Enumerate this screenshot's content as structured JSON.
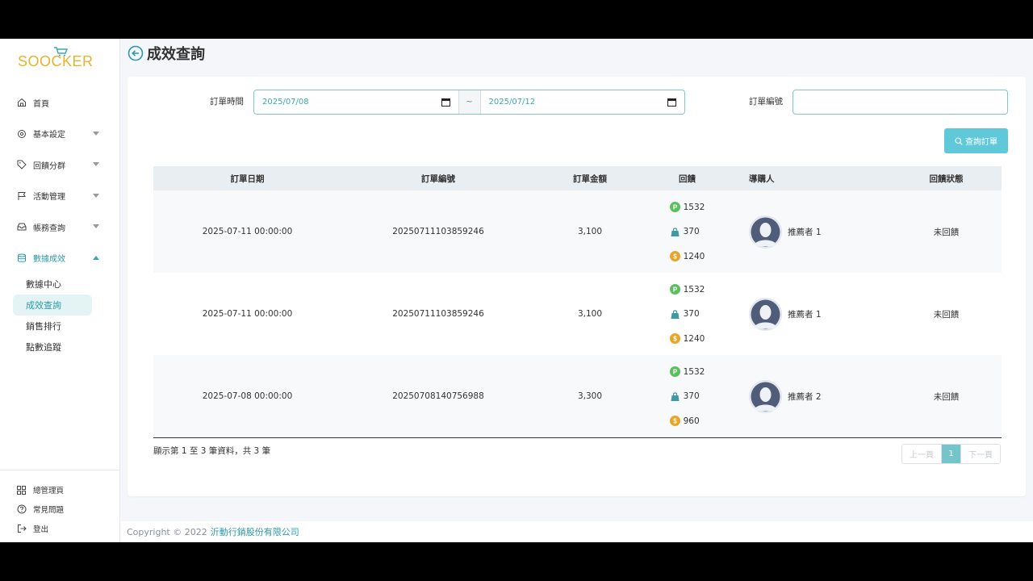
{
  "brand": {
    "logo_text": "SOOCKER",
    "accent": "#e8b22c"
  },
  "sidebar": {
    "items": [
      {
        "label": "首頁",
        "icon": "home-icon"
      },
      {
        "label": "基本設定",
        "icon": "gear-icon"
      },
      {
        "label": "回饋分群",
        "icon": "tag-icon"
      },
      {
        "label": "活動管理",
        "icon": "flag-icon"
      },
      {
        "label": "帳務查詢",
        "icon": "inbox-icon"
      },
      {
        "label": "數據成效",
        "icon": "database-icon"
      }
    ],
    "sub_items": [
      {
        "label": "數據中心"
      },
      {
        "label": "成效查詢"
      },
      {
        "label": "銷售排行"
      },
      {
        "label": "點數追蹤"
      }
    ],
    "bottom": [
      {
        "label": "總管理頁",
        "icon": "grid-icon"
      },
      {
        "label": "常見問題",
        "icon": "help-icon"
      },
      {
        "label": "登出",
        "icon": "logout-icon"
      }
    ]
  },
  "page": {
    "title": "成效查詢"
  },
  "filters": {
    "order_time_label": "訂單時間",
    "date_from": "2025/07/08",
    "date_to": "2025/07/12",
    "separator": "~",
    "order_no_label": "訂單編號",
    "order_no_value": "",
    "search_label": "查詢訂單"
  },
  "table": {
    "headers": [
      "訂單日期",
      "訂單編號",
      "訂單金額",
      "回饋",
      "導購人",
      "回饋狀態"
    ],
    "rows": [
      {
        "date": "2025-07-11 00:00:00",
        "order_no": "20250711103859246",
        "amount": "3,100",
        "points": "1532",
        "bag": "370",
        "coin": "1240",
        "referrer": "推薦者 1",
        "status": "未回饋"
      },
      {
        "date": "2025-07-11 00:00:00",
        "order_no": "20250711103859246",
        "amount": "3,100",
        "points": "1532",
        "bag": "370",
        "coin": "1240",
        "referrer": "推薦者 1",
        "status": "未回饋"
      },
      {
        "date": "2025-07-08 00:00:00",
        "order_no": "20250708140756988",
        "amount": "3,300",
        "points": "1532",
        "bag": "370",
        "coin": "960",
        "referrer": "推薦者 2",
        "status": "未回饋"
      }
    ]
  },
  "pagination": {
    "info": "顯示第 1 至 3 筆資料，共 3 筆",
    "prev": "上一頁",
    "current": "1",
    "next": "下一頁"
  },
  "footer": {
    "copyright": "Copyright © 2022",
    "company": "沂動行銷股份有限公司"
  },
  "colors": {
    "teal": "#3aa6b4",
    "button": "#5fc9d9",
    "points_green": "#5bbf5f",
    "coin_orange": "#e8a52a",
    "bag_teal": "#3f9aa5"
  }
}
